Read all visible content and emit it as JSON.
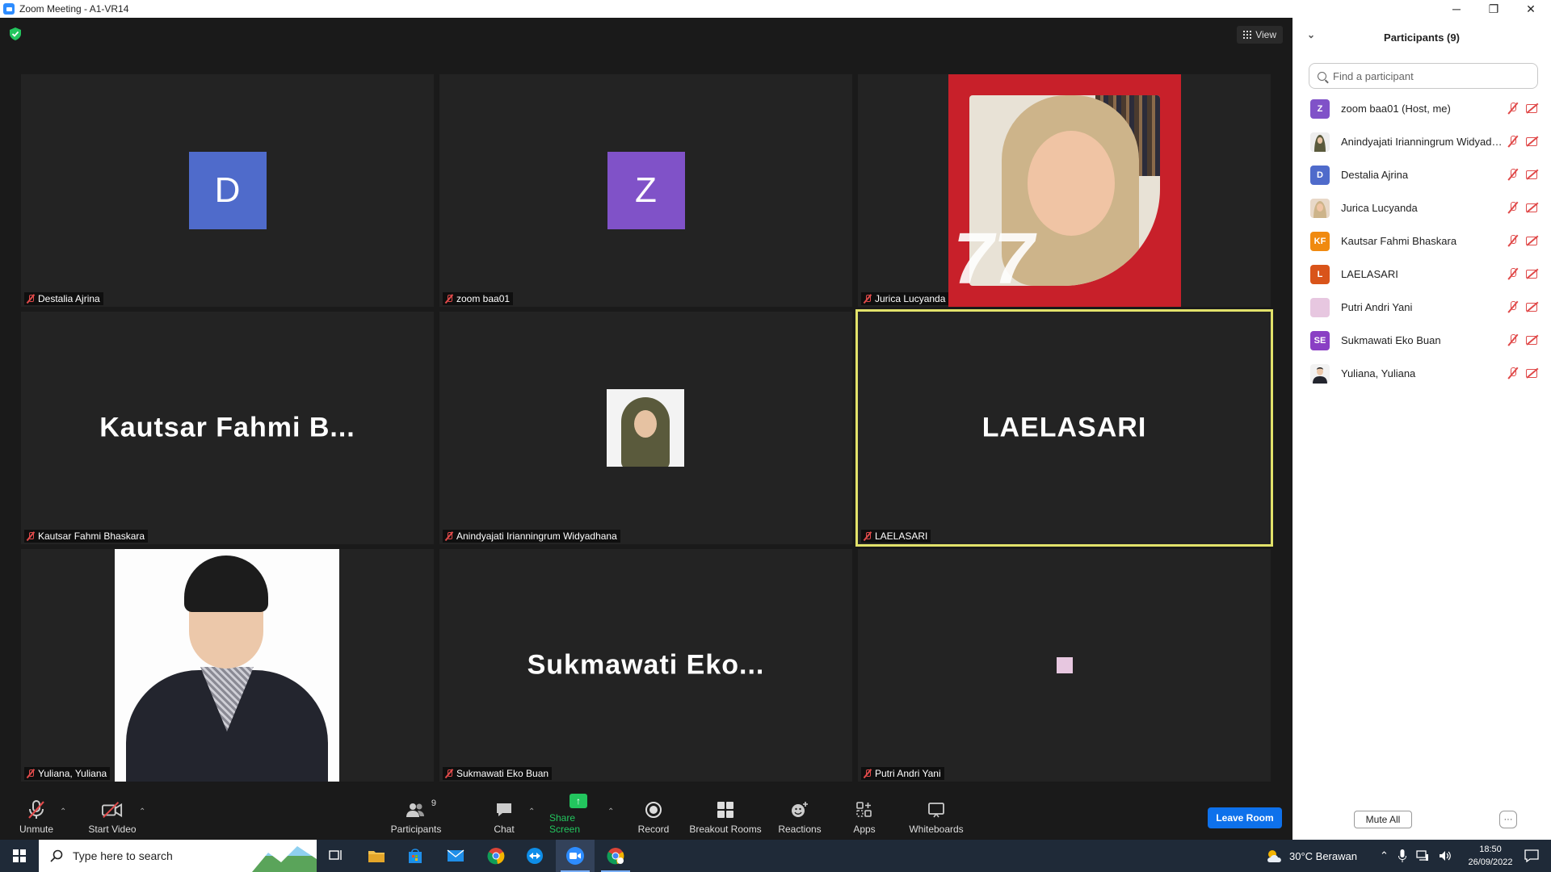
{
  "window": {
    "title": "Zoom Meeting - A1-VR14",
    "minimize": "─",
    "restore": "❐",
    "close": "✕"
  },
  "view_button": {
    "label": "View"
  },
  "tiles": [
    {
      "id": "destalia",
      "display": "avatar",
      "initial": "D",
      "avatar_color": "#4f6bcb",
      "name": "Destalia Ajrina"
    },
    {
      "id": "zoom",
      "display": "avatar",
      "initial": "Z",
      "avatar_color": "#8052c8",
      "name": "zoom baa01"
    },
    {
      "id": "jurica",
      "display": "photo",
      "name": "Jurica Lucyanda",
      "logo_text": "77"
    },
    {
      "id": "kautsar",
      "display": "text",
      "big_name": "Kautsar  Fahmi  B...",
      "name": "Kautsar Fahmi Bhaskara"
    },
    {
      "id": "anin",
      "display": "photo",
      "name": "Anindyajati Irianningrum Widyadhana"
    },
    {
      "id": "laela",
      "display": "text",
      "big_name": "LAELASARI",
      "name": "LAELASARI",
      "active": true
    },
    {
      "id": "yuliana",
      "display": "photo",
      "name": "Yuliana, Yuliana"
    },
    {
      "id": "sukma",
      "display": "text",
      "big_name": "Sukmawati  Eko...",
      "name": "Sukmawati Eko Buan"
    },
    {
      "id": "putri",
      "display": "square",
      "square_color": "#e7c7e0",
      "name": "Putri Andri Yani"
    }
  ],
  "toolbar": {
    "unmute": "Unmute",
    "start_video": "Start Video",
    "participants": "Participants",
    "participants_count": "9",
    "chat": "Chat",
    "share_screen": "Share Screen",
    "record": "Record",
    "breakout_rooms": "Breakout Rooms",
    "reactions": "Reactions",
    "apps": "Apps",
    "whiteboards": "Whiteboards",
    "leave": "Leave Room",
    "caret": "⌃"
  },
  "panel": {
    "title": "Participants (9)",
    "search_placeholder": "Find a participant",
    "mute_all": "Mute All",
    "more": "···",
    "participants": [
      {
        "name": "zoom baa01 (Host, me)",
        "initials": "Z",
        "color": "#8052c8"
      },
      {
        "name": "Anindyajati Irianningrum Widyadhana",
        "initials": "",
        "color": "#6a6a4a",
        "photo": true
      },
      {
        "name": "Destalia Ajrina",
        "initials": "D",
        "color": "#4f6bcb"
      },
      {
        "name": "Jurica Lucyanda",
        "initials": "",
        "color": "#d8a890",
        "photo": true
      },
      {
        "name": "Kautsar Fahmi Bhaskara",
        "initials": "KF",
        "color": "#f08a10"
      },
      {
        "name": "LAELASARI",
        "initials": "L",
        "color": "#d9541a"
      },
      {
        "name": "Putri Andri Yani",
        "initials": "",
        "color": "#e7c7e0"
      },
      {
        "name": "Sukmawati Eko Buan",
        "initials": "SE",
        "color": "#8a3fc4"
      },
      {
        "name": "Yuliana, Yuliana",
        "initials": "",
        "color": "#3a3a44",
        "photo": true
      }
    ]
  },
  "taskbar": {
    "search_placeholder": "Type here to search",
    "weather": "30°C  Berawan",
    "time": "18:50",
    "date": "26/09/2022"
  }
}
